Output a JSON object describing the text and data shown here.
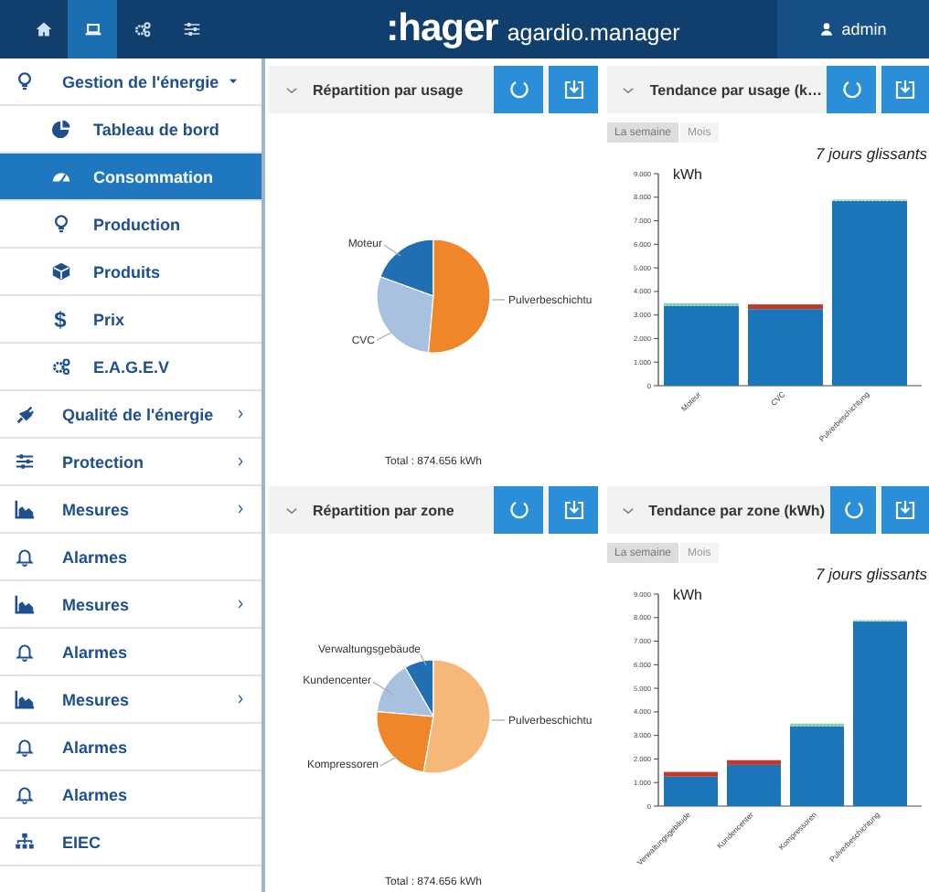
{
  "header": {
    "nav_tabs": [
      {
        "selected": false
      },
      {
        "selected": true
      },
      {
        "selected": false
      },
      {
        "selected": false
      }
    ],
    "logo": ":hager",
    "product": "agardio.manager",
    "user": "admin"
  },
  "sidebar": {
    "items": [
      {
        "label": "Gestion de l'énergie",
        "kind": "menu",
        "expanded": true,
        "selected": false,
        "children": [
          {
            "label": "Tableau de bord",
            "selected": false
          },
          {
            "label": "Consommation",
            "selected": true
          },
          {
            "label": "Production",
            "selected": false
          },
          {
            "label": "Produits",
            "selected": false
          },
          {
            "label": "Prix",
            "icon": "$",
            "selected": false
          },
          {
            "label": "E.A.G.E.V",
            "selected": false
          }
        ]
      },
      {
        "label": "Qualité de l'énergie",
        "kind": "menu",
        "expanded": false,
        "selected": false
      },
      {
        "label": "Protection",
        "kind": "menu",
        "expanded": false,
        "selected": false
      },
      {
        "label": "Mesures",
        "kind": "menu",
        "expanded": false,
        "selected": false
      },
      {
        "label": "Alarmes",
        "kind": "link",
        "selected": false
      },
      {
        "label": "Mesures",
        "kind": "menu",
        "expanded": false,
        "selected": false
      },
      {
        "label": "Alarmes",
        "kind": "link",
        "selected": false
      },
      {
        "label": "Mesures",
        "kind": "menu",
        "expanded": false,
        "selected": false
      },
      {
        "label": "Alarmes",
        "kind": "link",
        "selected": false
      },
      {
        "label": "Alarmes",
        "kind": "link",
        "selected": false
      },
      {
        "label": "EIEC",
        "kind": "link",
        "selected": false
      }
    ]
  },
  "panels": [
    {
      "kind": "pie",
      "title": "Répartition par usage",
      "slices": [
        {
          "label": "Moteur",
          "color": "#1f6fb2"
        },
        {
          "label": "CVC",
          "color": "#a9c1e0"
        },
        {
          "label": "Pulverbeschichtu",
          "color": "#f0862a"
        }
      ],
      "total": "Total : 874.656 kWh"
    },
    {
      "kind": "bar",
      "title": "Tendance par usage (k…",
      "periods": [
        {
          "label": "La semaine",
          "selected": true
        },
        {
          "label": "Mois",
          "selected": false
        }
      ],
      "chart_title": "7 jours glissants",
      "unit": "kWh",
      "chart_data": {
        "type": "bar",
        "stacked": true,
        "categories": [
          "Moteur",
          "CVC",
          "Pulverbeschichtung"
        ],
        "series": [
          {
            "color": "#1b75b8",
            "values": [
              3400,
              3250,
              7850
            ]
          },
          {
            "color": "#c0392b",
            "values": [
              0,
              200,
              0
            ]
          },
          {
            "color": "#7ed0a0",
            "values": [
              100,
              0,
              50
            ]
          }
        ],
        "ylim": [
          0,
          9000
        ],
        "yticks": [
          {
            "value": 0,
            "label": "0"
          },
          {
            "value": 1000,
            "label": "1.000"
          },
          {
            "value": 2000,
            "label": "2.000"
          },
          {
            "value": 3000,
            "label": "3.000"
          },
          {
            "value": 4000,
            "label": "4.000"
          },
          {
            "value": 5000,
            "label": "5.000"
          },
          {
            "value": 6000,
            "label": "6.000"
          },
          {
            "value": 7000,
            "label": "7.000"
          },
          {
            "value": 8000,
            "label": "8.000"
          },
          {
            "value": 9000,
            "label": "9.000"
          }
        ]
      }
    },
    {
      "kind": "pie",
      "title": "Répartition par zone",
      "slices": [
        {
          "label": "Verwaltungsgebäude",
          "color": "#1f6fb2"
        },
        {
          "label": "Kundencenter",
          "color": "#a9c1e0"
        },
        {
          "label": "Kompressoren",
          "color": "#f0862a"
        },
        {
          "label": "Pulverbeschichtu",
          "color": "#f5b878"
        }
      ],
      "total": "Total : 874.656 kWh"
    },
    {
      "kind": "bar",
      "title": "Tendance par zone (kWh)",
      "periods": [
        {
          "label": "La semaine",
          "selected": true
        },
        {
          "label": "Mois",
          "selected": false
        }
      ],
      "chart_title": "7 jours glissants",
      "unit": "kWh",
      "chart_data": {
        "type": "bar",
        "stacked": true,
        "categories": [
          "Verwaltungsgebäude",
          "Kundencenter",
          "Kompressoren",
          "Pulverbeschichtung"
        ],
        "series": [
          {
            "color": "#1b75b8",
            "values": [
              1250,
              1750,
              3400,
              7850
            ]
          },
          {
            "color": "#c0392b",
            "values": [
              200,
              200,
              0,
              0
            ]
          },
          {
            "color": "#7ed0a0",
            "values": [
              0,
              0,
              100,
              50
            ]
          }
        ],
        "ylim": [
          0,
          9000
        ],
        "yticks": [
          {
            "value": 0,
            "label": "0"
          },
          {
            "value": 1000,
            "label": "1.000"
          },
          {
            "value": 2000,
            "label": "2.000"
          },
          {
            "value": 3000,
            "label": "3.000"
          },
          {
            "value": 4000,
            "label": "4.000"
          },
          {
            "value": 5000,
            "label": "5.000"
          },
          {
            "value": 6000,
            "label": "6.000"
          },
          {
            "value": 7000,
            "label": "7.000"
          },
          {
            "value": 8000,
            "label": "8.000"
          },
          {
            "value": 9000,
            "label": "9.000"
          }
        ]
      }
    }
  ]
}
